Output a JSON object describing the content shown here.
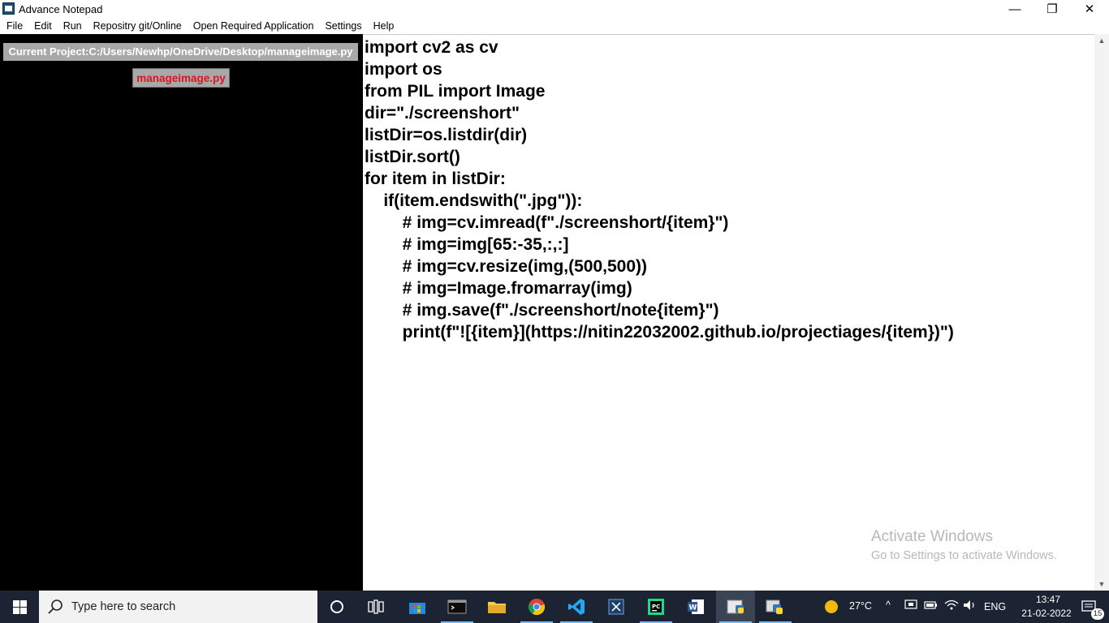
{
  "window": {
    "title": "Advance Notepad"
  },
  "window_controls": {
    "minimize": "—",
    "maximize": "❐",
    "close": "✕"
  },
  "menu": [
    "File",
    "Edit",
    "Run",
    "Repositry git/Online",
    "Open Required Application",
    "Settings",
    "Help"
  ],
  "sidebar": {
    "project_label": "Current Project:C:/Users/Newhp/OneDrive/Desktop/manageimage.py",
    "files": [
      "manageimage.py"
    ]
  },
  "editor": {
    "code": "import cv2 as cv\nimport os\nfrom PIL import Image\ndir=\"./screenshort\"\nlistDir=os.listdir(dir)\nlistDir.sort()\nfor item in listDir:\n    if(item.endswith(\".jpg\")):\n        # img=cv.imread(f\"./screenshort/{item}\")\n        # img=img[65:-35,:,:]\n        # img=cv.resize(img,(500,500))\n        # img=Image.fromarray(img)\n        # img.save(f\"./screenshort/note{item}\")\n        print(f\"![{item}](https://nitin22032002.github.io/projectiages/{item})\")"
  },
  "watermark": {
    "line1": "Activate Windows",
    "line2": "Go to Settings to activate Windows."
  },
  "taskbar": {
    "search_placeholder": "Type here to search",
    "apps": [
      "cortana-icon",
      "task-view-icon",
      "store-icon",
      "terminal-icon",
      "file-explorer-icon",
      "chrome-icon",
      "vscode-icon",
      "snipping-icon",
      "pycharm-icon",
      "word-icon",
      "python-app-icon",
      "python-idle-icon"
    ],
    "weather": "27°C",
    "language": "ENG",
    "time": "13:47",
    "date": "21-02-2022",
    "notifications": "15"
  },
  "colors": {
    "sidebar_bg": "#000000",
    "project_label_bg": "#a8a8a8",
    "file_text": "#e0141e",
    "taskbar_bg": "#1c2433"
  }
}
